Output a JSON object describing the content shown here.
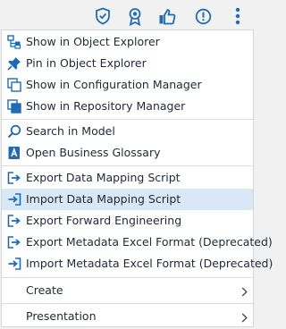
{
  "toolbar": {
    "buttons": [
      {
        "icon": "shield-check-icon"
      },
      {
        "icon": "award-ribbon-icon"
      },
      {
        "icon": "thumbs-up-icon"
      },
      {
        "icon": "alert-circle-icon"
      },
      {
        "icon": "more-vertical-icon"
      }
    ],
    "accent_color": "#1f6bb5"
  },
  "menu": {
    "group1": [
      {
        "label": "Show in Object Explorer",
        "icon": "object-explorer-icon"
      },
      {
        "label": "Pin in Object Explorer",
        "icon": "pin-icon"
      },
      {
        "label": "Show in Configuration Manager",
        "icon": "configuration-manager-icon"
      },
      {
        "label": "Show in Repository Manager",
        "icon": "repository-manager-icon"
      }
    ],
    "group2": [
      {
        "label": "Search in Model",
        "icon": "search-icon"
      },
      {
        "label": "Open Business Glossary",
        "icon": "glossary-icon"
      }
    ],
    "group3": [
      {
        "label": "Export Data Mapping Script",
        "icon": "export-icon"
      },
      {
        "label": "Import Data Mapping Script",
        "icon": "import-icon",
        "highlighted": true
      },
      {
        "label": "Export Forward Engineering",
        "icon": "export-icon"
      },
      {
        "label": "Export Metadata Excel Format (Deprecated)",
        "icon": "export-icon"
      },
      {
        "label": "Import Metadata Excel Format (Deprecated)",
        "icon": "import-icon"
      }
    ],
    "submenus": [
      {
        "label": "Create",
        "icon": "chevron-right-icon"
      },
      {
        "label": "Presentation",
        "icon": "chevron-right-icon"
      }
    ],
    "highlight_color": "#d9e8f6"
  }
}
